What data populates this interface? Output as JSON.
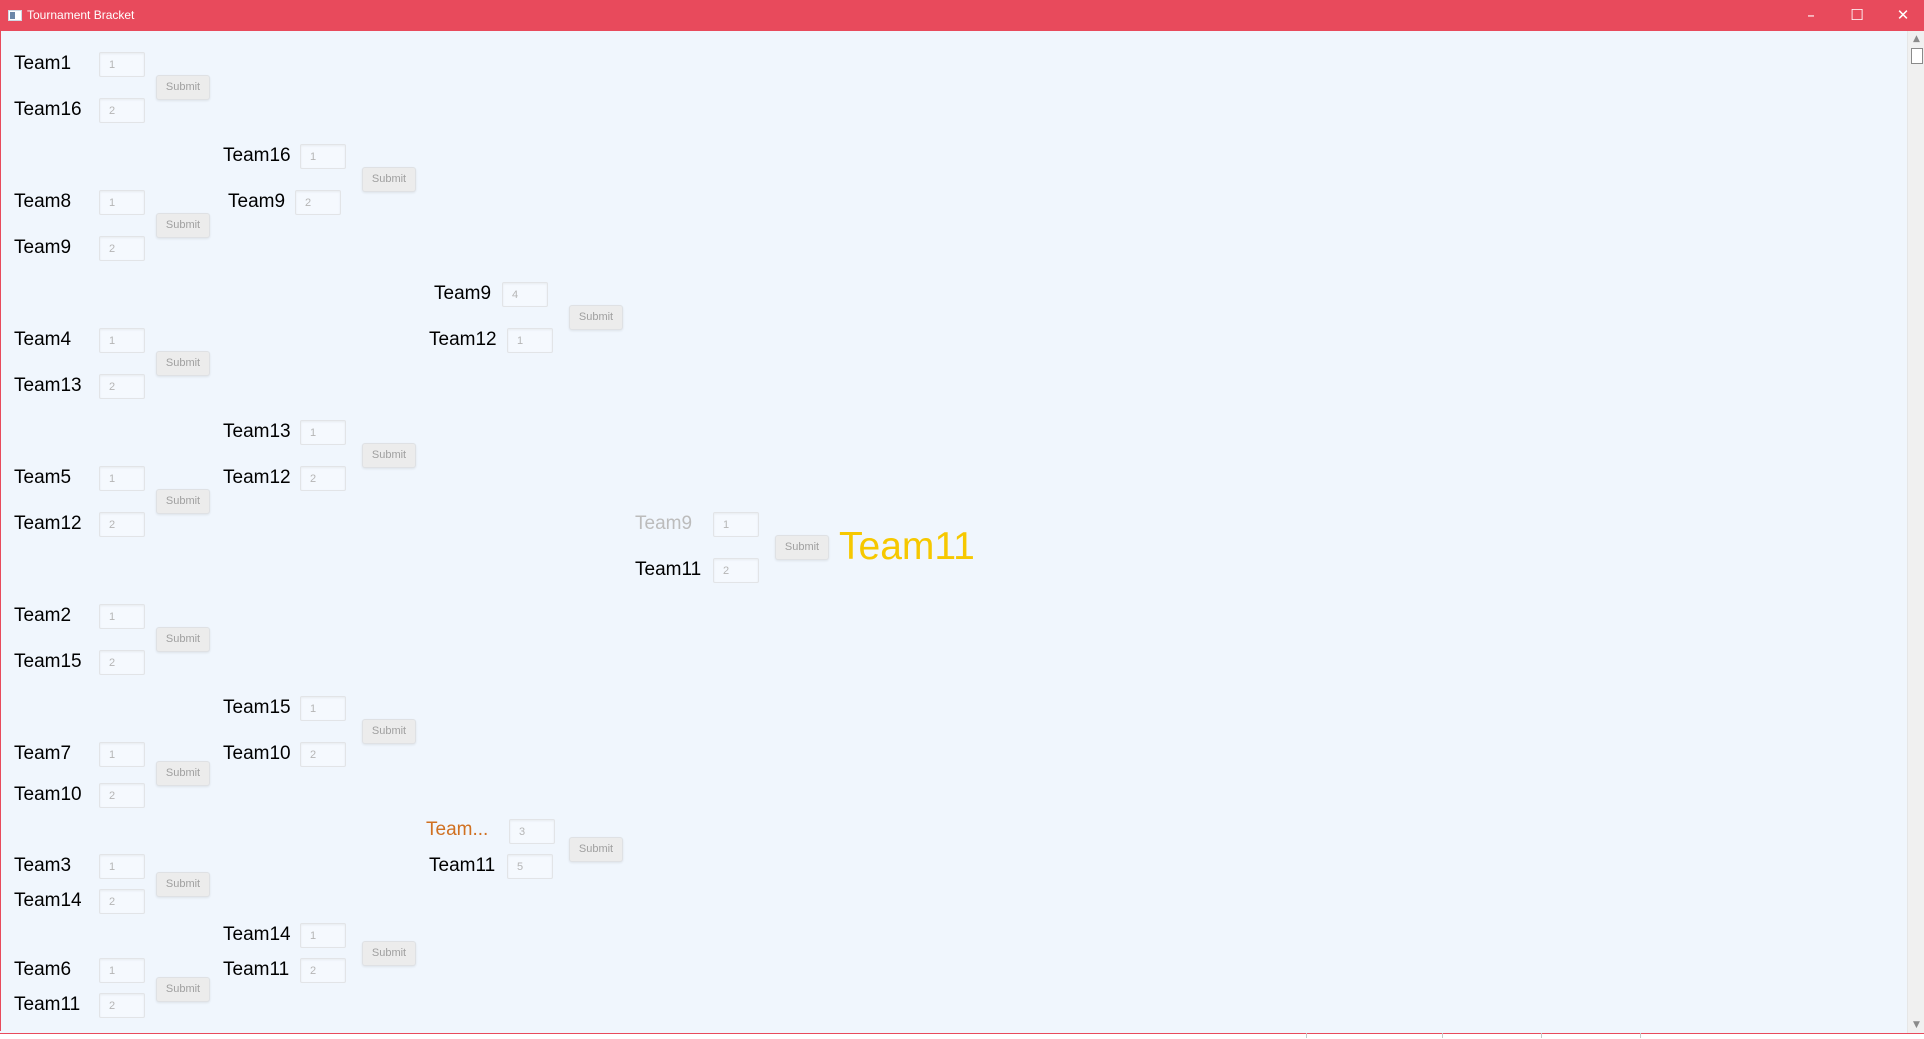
{
  "window": {
    "title": "Tournament Bracket",
    "accent_color": "#e84a5c",
    "background_color": "#f0f6fd",
    "controls": {
      "minimize": "–",
      "maximize": "☐",
      "close": "✕"
    }
  },
  "submit_label": "Submit",
  "round1": [
    {
      "team_a": "Team1",
      "score_a": "1",
      "team_b": "Team16",
      "score_b": "2"
    },
    {
      "team_a": "Team8",
      "score_a": "1",
      "team_b": "Team9",
      "score_b": "2"
    },
    {
      "team_a": "Team4",
      "score_a": "1",
      "team_b": "Team13",
      "score_b": "2"
    },
    {
      "team_a": "Team5",
      "score_a": "1",
      "team_b": "Team12",
      "score_b": "2"
    },
    {
      "team_a": "Team2",
      "score_a": "1",
      "team_b": "Team15",
      "score_b": "2"
    },
    {
      "team_a": "Team7",
      "score_a": "1",
      "team_b": "Team10",
      "score_b": "2"
    },
    {
      "team_a": "Team3",
      "score_a": "1",
      "team_b": "Team14",
      "score_b": "2"
    },
    {
      "team_a": "Team6",
      "score_a": "1",
      "team_b": "Team11",
      "score_b": "2"
    }
  ],
  "round2": [
    {
      "team_a": "Team16",
      "score_a": "1",
      "team_b": "Team9",
      "score_b": "2"
    },
    {
      "team_a": "Team13",
      "score_a": "1",
      "team_b": "Team12",
      "score_b": "2"
    },
    {
      "team_a": "Team15",
      "score_a": "1",
      "team_b": "Team10",
      "score_b": "2"
    },
    {
      "team_a": "Team14",
      "score_a": "1",
      "team_b": "Team11",
      "score_b": "2"
    }
  ],
  "round3": [
    {
      "team_a": "Team9",
      "score_a": "4",
      "team_b": "Team12",
      "score_b": "1"
    },
    {
      "team_a": "Team...",
      "score_a": "3",
      "team_b": "Team11",
      "score_b": "5"
    }
  ],
  "final": {
    "team_a": "Team9",
    "score_a": "1",
    "team_b": "Team11",
    "score_b": "2"
  },
  "champion": "Team11",
  "colors": {
    "champion": "#f6c800",
    "highlight_team": "#d07020",
    "eliminated_team": "#bcbcbc"
  }
}
